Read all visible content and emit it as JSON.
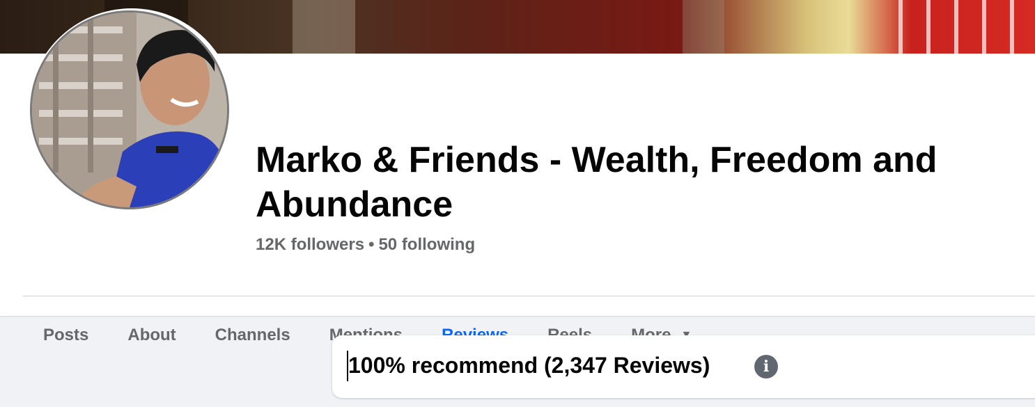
{
  "profile": {
    "name": "Marko & Friends - Wealth, Freedom and Abundance",
    "followers": "12K followers",
    "separator": "•",
    "following": "50 following"
  },
  "tabs": [
    {
      "label": "Posts"
    },
    {
      "label": "About"
    },
    {
      "label": "Channels"
    },
    {
      "label": "Mentions"
    },
    {
      "label": "Reviews",
      "active": true
    },
    {
      "label": "Reels"
    },
    {
      "label": "More",
      "icon": "caret-down-icon"
    }
  ],
  "reviews": {
    "summary": "100% recommend (2,347 Reviews)",
    "info_icon": "info-icon",
    "info_glyph": "i"
  },
  "colors": {
    "accent": "#0866ff",
    "text_primary": "#050505",
    "text_secondary": "#65676b",
    "background": "#f0f2f5"
  }
}
